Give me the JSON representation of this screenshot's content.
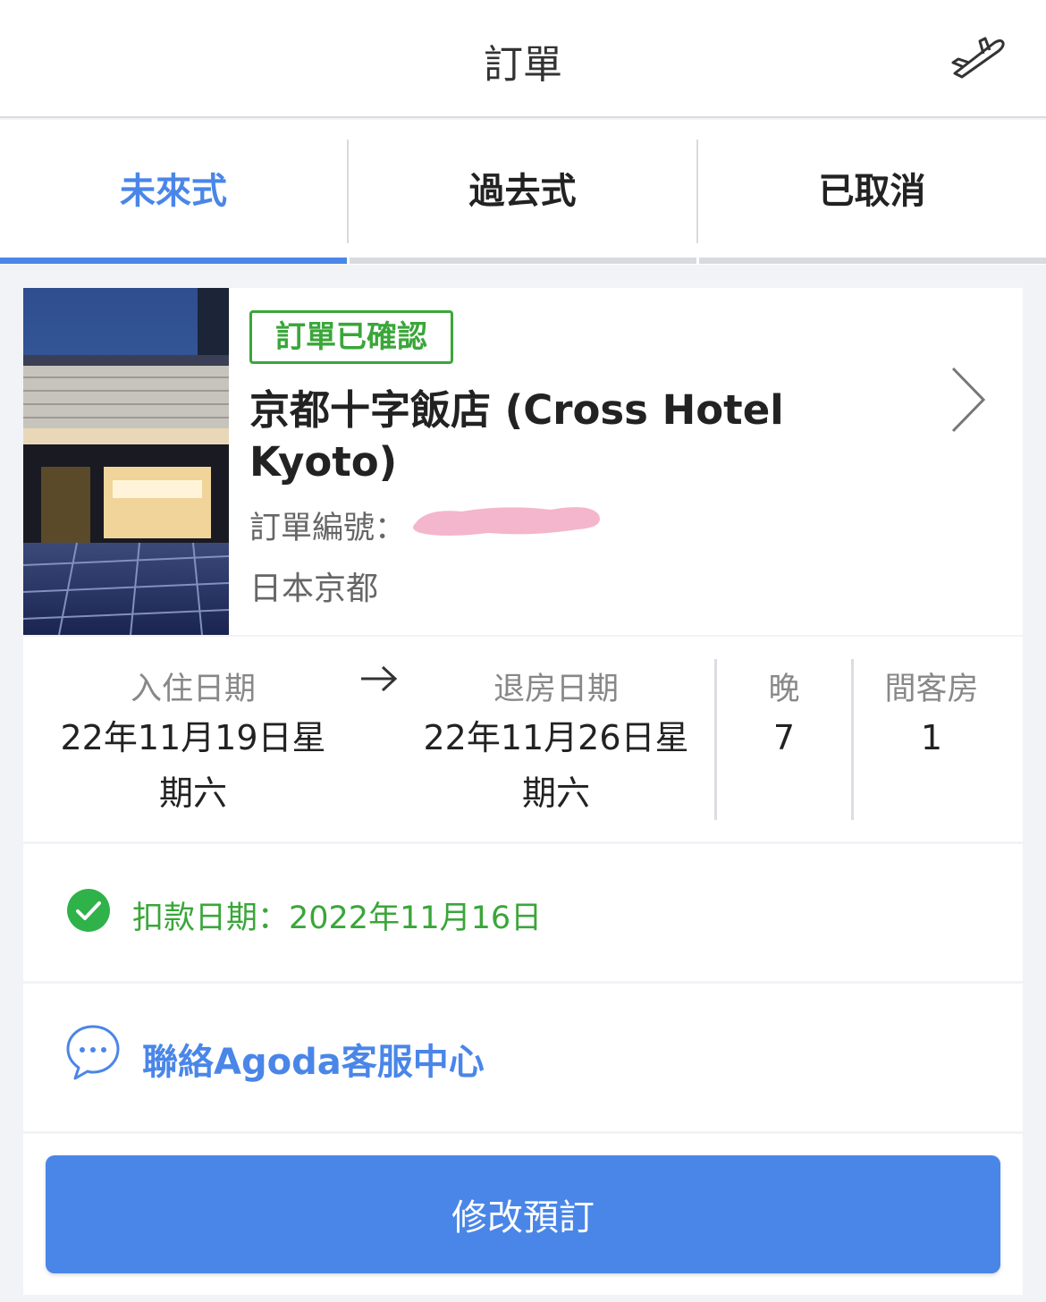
{
  "header": {
    "title": "訂單"
  },
  "tabs": [
    {
      "label": "未來式",
      "active": true
    },
    {
      "label": "過去式",
      "active": false
    },
    {
      "label": "已取消",
      "active": false
    }
  ],
  "booking": {
    "status": "訂單已確認",
    "hotel_name": "京都十字飯店 (Cross Hotel Kyoto)",
    "booking_number_label": "訂單編號：",
    "location": "日本京都"
  },
  "stay": {
    "checkin_label": "入住日期",
    "checkin_date": "22年11月19日星期六",
    "checkout_label": "退房日期",
    "checkout_date": "22年11月26日星期六",
    "nights_label": "晚",
    "nights": "7",
    "rooms_label": "間客房",
    "rooms": "1"
  },
  "payment": {
    "text": "扣款日期：2022年11月16日"
  },
  "contact": {
    "label": "聯絡Agoda客服中心"
  },
  "actions": {
    "modify_label": "修改預訂"
  },
  "colors": {
    "accent": "#4a86e8",
    "success": "#3aa63a"
  }
}
